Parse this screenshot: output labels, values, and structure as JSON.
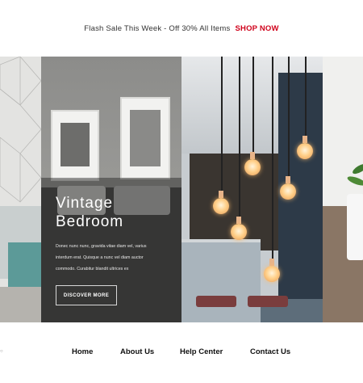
{
  "flash_bar": {
    "text": "Flash Sale This Week - Off 30% All Items",
    "link": "SHOP NOW",
    "link_color": "#d0021b"
  },
  "hero": {
    "title_line1": "Vintage",
    "title_line2": "Bedroom",
    "description_lines": [
      "Donec nunc nunc, gravida vitae diam vel, varius",
      "interdum erat. Quisque a nunc vel diam auctor",
      "commodo. Curabitur blandit ultrices ex"
    ],
    "button_label": "DISCOVER MORE"
  },
  "nav": {
    "items": [
      {
        "label": "Home"
      },
      {
        "label": "About Us"
      },
      {
        "label": "Help Center"
      },
      {
        "label": "Contact Us"
      }
    ]
  }
}
